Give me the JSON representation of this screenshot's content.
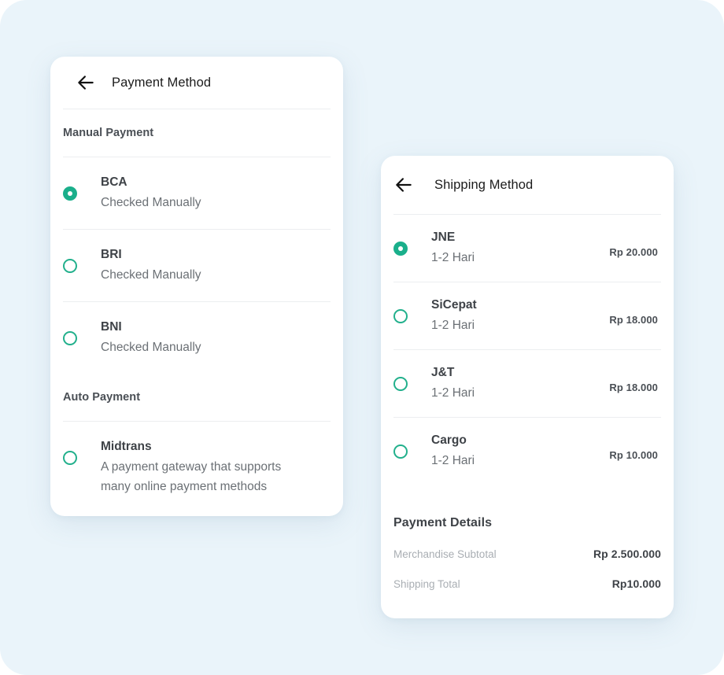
{
  "theme": {
    "page_background": "#eaf4fa",
    "card_background": "#ffffff",
    "accent": "#1aaf8b",
    "divider": "#eceef0",
    "title_text": "#1b1b1b",
    "primary_text": "#3e4247",
    "secondary_text": "#6b7075",
    "muted_text": "#a9aeb3"
  },
  "payment_card": {
    "back_icon": "arrow-left-icon",
    "title": "Payment Method",
    "sections": [
      {
        "label": "Manual Payment",
        "options": [
          {
            "name": "BCA",
            "description": "Checked Manually",
            "selected": true
          },
          {
            "name": "BRI",
            "description": "Checked Manually",
            "selected": false
          },
          {
            "name": "BNI",
            "description": "Checked Manually",
            "selected": false
          }
        ]
      },
      {
        "label": "Auto Payment",
        "options": [
          {
            "name": "Midtrans",
            "description": "A payment gateway that supports many online payment methods",
            "selected": false
          }
        ]
      }
    ]
  },
  "shipping_card": {
    "back_icon": "arrow-left-icon",
    "title": "Shipping Method",
    "options": [
      {
        "name": "JNE",
        "eta": "1-2 Hari",
        "price": "Rp 20.000",
        "selected": true
      },
      {
        "name": "SiCepat",
        "eta": "1-2 Hari",
        "price": "Rp 18.000",
        "selected": false
      },
      {
        "name": "J&T",
        "eta": "1-2 Hari",
        "price": "Rp 18.000",
        "selected": false
      },
      {
        "name": "Cargo",
        "eta": "1-2 Hari",
        "price": "Rp 10.000",
        "selected": false
      }
    ],
    "payment_details": {
      "title": "Payment Details",
      "rows": [
        {
          "label": "Merchandise Subtotal",
          "value": "Rp 2.500.000"
        },
        {
          "label": "Shipping Total",
          "value": "Rp10.000"
        }
      ]
    }
  }
}
